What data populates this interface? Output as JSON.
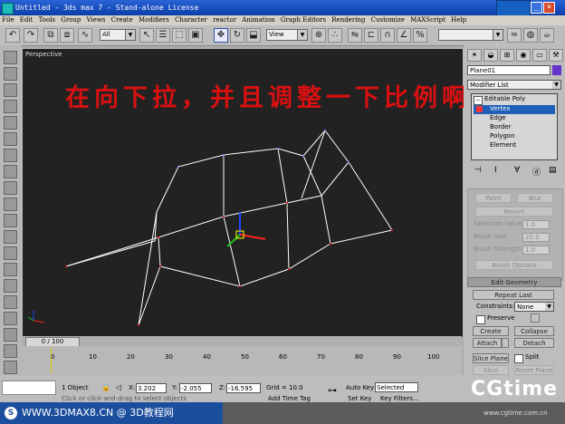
{
  "title_bar": {
    "text": "Untitled - 3ds max 7 - Stand-alone License"
  },
  "menu": [
    "File",
    "Edit",
    "Tools",
    "Group",
    "Views",
    "Create",
    "Modifiers",
    "Character",
    "reactor",
    "Animation",
    "Graph Editors",
    "Rendering",
    "Customize",
    "MAXScript",
    "Help"
  ],
  "toolbar": {
    "selection_filter": "All",
    "ref_coord": "View"
  },
  "viewport": {
    "label": "Perspective",
    "overlay_text": "在向下拉，并且调整一下比例啊"
  },
  "command_panel": {
    "object_name": "Plane01",
    "modifier_list": "Modifier List",
    "stack": {
      "root": "Editable Poly",
      "items": [
        "Vertex",
        "Edge",
        "Border",
        "Polygon",
        "Element"
      ]
    },
    "soft_sel": {
      "paint": "Paint",
      "blur": "Blur",
      "revert": "Revert",
      "selection_value_label": "Selection Value",
      "selection_value": "1.0",
      "brush_size_label": "Brush Size",
      "brush_size": "20.0",
      "brush_strength_label": "Brush Strength",
      "brush_strength": "1.0",
      "brush_options": "Brush Options"
    },
    "edit_geometry": {
      "rollout": "Edit Geometry",
      "repeat_last": "Repeat Last",
      "constraints_label": "Constraints:",
      "constraints_value": "None",
      "preserve": "Preserve",
      "create": "Create",
      "collapse": "Collapse",
      "attach": "Attach",
      "detach": "Detach",
      "slice_plane": "Slice Plane",
      "split": "Split",
      "slice": "Slice",
      "reset_plane": "Reset Plane"
    }
  },
  "timeline": {
    "slider": "0 / 100",
    "ticks": [
      "0",
      "10",
      "20",
      "30",
      "40",
      "50",
      "60",
      "70",
      "80",
      "90",
      "100"
    ]
  },
  "status": {
    "selection": "1 Object",
    "x_label": "X:",
    "x": "3.202",
    "y_label": "Y:",
    "y": "-2.055",
    "z_label": "Z:",
    "z": "-16.595",
    "grid": "Grid = 10.0",
    "auto_key": "Auto Key",
    "auto_key_mode": "Selected",
    "set_key": "Set Key",
    "key_filters": "Key Filters...",
    "prompt": "Click or click-and-drag to select objects",
    "add_time_tag": "Add Time Tag"
  },
  "footer": {
    "watermark": "WWW.3DMAX8.CN @ 3D教程网",
    "brand": "CGtime",
    "brand_url": "www.cgtime.com.cn"
  }
}
